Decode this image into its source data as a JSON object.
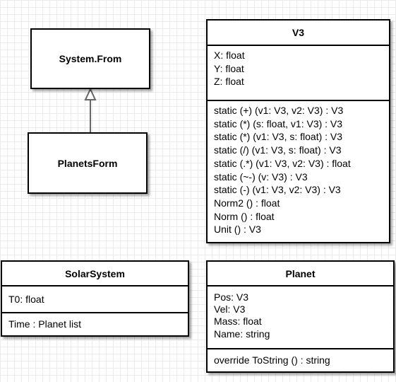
{
  "system_from": {
    "title": "System.From"
  },
  "planets_form": {
    "title": "PlanetsForm"
  },
  "v3": {
    "title": "V3",
    "attributes": [
      "X: float",
      "Y: float",
      "Z: float"
    ],
    "methods": [
      "static (+) (v1: V3, v2: V3) : V3",
      "static (*) (s: float, v1: V3) : V3",
      "static (*) (v1: V3, s: float) : V3",
      "static (/) (v1: V3, s: float) : V3",
      "static (.*) (v1: V3, v2: V3) : float",
      "static (~-) (v: V3) : V3",
      "static (-) (v1: V3, v2: V3) : V3",
      "Norm2 () : float",
      "Norm () : float",
      "Unit () : V3"
    ]
  },
  "solar_system": {
    "title": "SolarSystem",
    "attributes": [
      "T0: float"
    ],
    "methods": [
      "Time : Planet list"
    ]
  },
  "planet": {
    "title": "Planet",
    "attributes": [
      "Pos: V3",
      "Vel: V3",
      "Mass: float",
      "Name: string"
    ],
    "methods": [
      "override ToString () : string"
    ]
  }
}
